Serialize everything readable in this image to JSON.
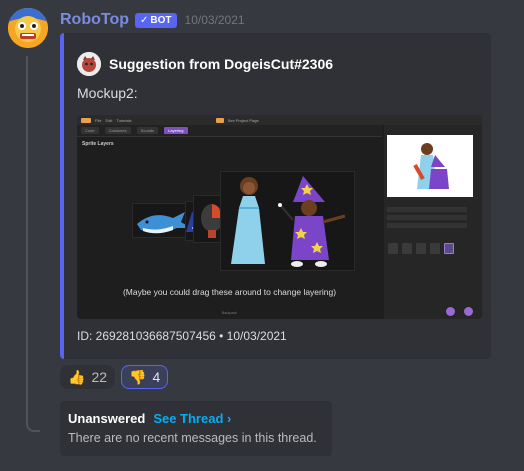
{
  "message": {
    "username": "RoboTop",
    "bot_badge": "BOT",
    "timestamp": "10/03/2021"
  },
  "embed": {
    "accent_color": "#5865f2",
    "author": "Suggestion from DogeisCut#2306",
    "description": "Mockup2:",
    "footer": "ID: 269281036687507456 • 10/03/2021",
    "image": {
      "editor_title": "Sprite Layers",
      "caption": "(Maybe you could drag these around to change layering)",
      "tabs": [
        "Code",
        "Costumes",
        "Sounds",
        "Layering"
      ],
      "menu": [
        "File",
        "Edit",
        "Tutorials",
        "Share",
        "See Project Page"
      ],
      "bottom_label": "Backpack"
    }
  },
  "reactions": [
    {
      "icon": "thumbs-up-icon",
      "emoji": "👍",
      "count": "22",
      "me": false
    },
    {
      "icon": "thumbs-down-icon",
      "emoji": "👎",
      "count": "4",
      "me": true
    }
  ],
  "thread": {
    "status": "Unanswered",
    "link": "See Thread ›",
    "empty_text": "There are no recent messages in this thread."
  },
  "colors": {
    "background": "#36393f",
    "embed_bg": "#2f3136",
    "username": "#7b8cde",
    "link": "#00aff4",
    "blurple": "#5865f2"
  }
}
